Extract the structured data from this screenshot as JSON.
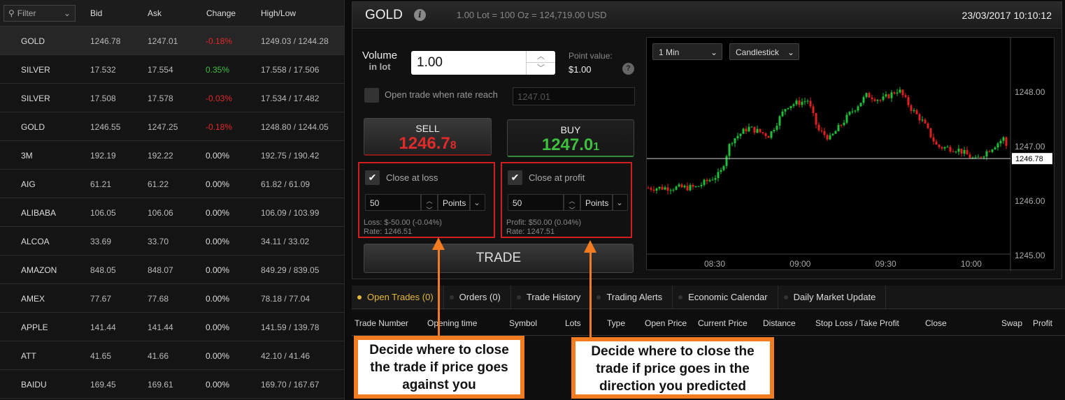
{
  "watchlist": {
    "filter_placeholder": "Filter",
    "headers": [
      "Bid",
      "Ask",
      "Change",
      "High/Low"
    ],
    "rows": [
      {
        "symbol": "GOLD",
        "bid": "1246.78",
        "ask": "1247.01",
        "change": "-0.18%",
        "hl": "1249.03 / 1244.28",
        "dir": "down"
      },
      {
        "symbol": "SILVER",
        "bid": "17.532",
        "ask": "17.554",
        "change": "0.35%",
        "hl": "17.558 / 17.506",
        "dir": "up"
      },
      {
        "symbol": "SILVER",
        "bid": "17.508",
        "ask": "17.578",
        "change": "-0.03%",
        "hl": "17.534 / 17.482",
        "dir": "down"
      },
      {
        "symbol": "GOLD",
        "bid": "1246.55",
        "ask": "1247.25",
        "change": "-0.18%",
        "hl": "1248.80 / 1244.05",
        "dir": "down"
      },
      {
        "symbol": "3M",
        "bid": "192.19",
        "ask": "192.22",
        "change": "0.00%",
        "hl": "192.75 / 190.42",
        "dir": "flat"
      },
      {
        "symbol": "AIG",
        "bid": "61.21",
        "ask": "61.22",
        "change": "0.00%",
        "hl": "61.82 / 61.09",
        "dir": "flat"
      },
      {
        "symbol": "ALIBABA",
        "bid": "106.05",
        "ask": "106.06",
        "change": "0.00%",
        "hl": "106.09 / 103.99",
        "dir": "flat"
      },
      {
        "symbol": "ALCOA",
        "bid": "33.69",
        "ask": "33.70",
        "change": "0.00%",
        "hl": "34.11 / 33.02",
        "dir": "flat"
      },
      {
        "symbol": "AMAZON",
        "bid": "848.05",
        "ask": "848.07",
        "change": "0.00%",
        "hl": "849.29 / 839.05",
        "dir": "flat"
      },
      {
        "symbol": "AMEX",
        "bid": "77.67",
        "ask": "77.68",
        "change": "0.00%",
        "hl": "78.18 / 77.04",
        "dir": "flat"
      },
      {
        "symbol": "APPLE",
        "bid": "141.44",
        "ask": "141.44",
        "change": "0.00%",
        "hl": "141.59 / 139.78",
        "dir": "flat"
      },
      {
        "symbol": "ATT",
        "bid": "41.65",
        "ask": "41.66",
        "change": "0.00%",
        "hl": "42.10 / 41.46",
        "dir": "flat"
      },
      {
        "symbol": "BAIDU",
        "bid": "169.45",
        "ask": "169.61",
        "change": "0.00%",
        "hl": "169.70 / 167.67",
        "dir": "flat"
      }
    ]
  },
  "header": {
    "symbol": "GOLD",
    "lot_info": "1.00 Lot = 100 Oz = 124,719.00 USD",
    "datetime": "23/03/2017 10:10:12"
  },
  "order": {
    "volume_label": "Volume",
    "volume_sub": "in lot",
    "volume": "1.00",
    "point_value_label": "Point value:",
    "point_value": "$1.00",
    "open_when_label": "Open trade when rate reach",
    "open_when_value": "1247.01",
    "sell_label": "SELL",
    "sell_main": "1246.7",
    "sell_tail": "8",
    "buy_label": "BUY",
    "buy_main": "1247.0",
    "buy_tail": "1",
    "loss": {
      "label": "Close at loss",
      "checked": true,
      "value": "50",
      "unit": "Points",
      "info": "Loss: $-50.00 (-0.04%)",
      "rate": "Rate: 1246.51"
    },
    "profit": {
      "label": "Close at profit",
      "checked": true,
      "value": "50",
      "unit": "Points",
      "info": "Profit: $50.00 (0.04%)",
      "rate": "Rate: 1247.51"
    },
    "trade_label": "TRADE"
  },
  "chart": {
    "timeframe": "1 Min",
    "type": "Candlestick",
    "current_price": "1246.78",
    "y_ticks": [
      "1248.00",
      "1247.00",
      "1246.00",
      "1245.00"
    ],
    "x_ticks": [
      "08:30",
      "09:00",
      "09:30",
      "10:00"
    ],
    "up_color": "#1fbf3a",
    "down_color": "#e02020"
  },
  "tabs": [
    {
      "label": "Open Trades (0)",
      "active": true
    },
    {
      "label": "Orders (0)"
    },
    {
      "label": "Trade History"
    },
    {
      "label": "Trading Alerts"
    },
    {
      "label": "Economic Calendar"
    },
    {
      "label": "Daily Market Update"
    }
  ],
  "columns": [
    "Trade Number",
    "Opening time",
    "Symbol",
    "Lots",
    "Type",
    "Open Price",
    "Current Price",
    "Distance",
    "Stop Loss / Take Profit",
    "Close",
    "Swap",
    "Profit"
  ],
  "callouts": {
    "loss": "Decide where to close the trade if price goes against you",
    "profit": "Decide where to close the trade if price goes in the direction you predicted"
  }
}
